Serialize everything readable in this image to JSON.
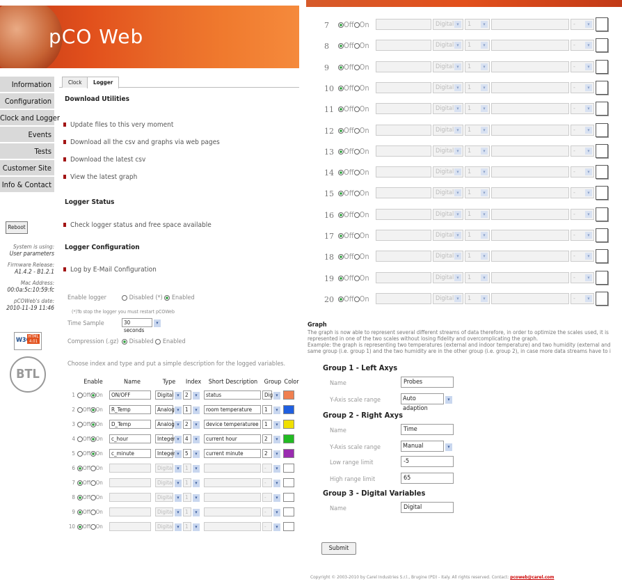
{
  "app": {
    "logo": "pCO Web"
  },
  "nav": [
    "Information",
    "Configuration",
    "Clock and Logger",
    "Events",
    "Tests",
    "Customer Site",
    "Info & Contact"
  ],
  "reboot_label": "Reboot",
  "sysinfo": [
    {
      "label": "System is using:",
      "value": "User parameters"
    },
    {
      "label": "Firmware Release:",
      "value": "A1.4.2 - B1.2.1"
    },
    {
      "label": "Mac Address:",
      "value": "00:0a:5c:10:59:fc"
    },
    {
      "label": "pCOWeb's date:",
      "value": "2010-11-19 11:46"
    }
  ],
  "badge": {
    "w3c": "W3C",
    "html": "HTML 4.01"
  },
  "seal_text": "BTL",
  "tabs": [
    "Clock",
    "Logger"
  ],
  "download": {
    "title": "Download Utilities",
    "items": [
      "Update files to this very moment",
      "Download all the csv and graphs via web pages",
      "Download the latest csv",
      "View the latest graph"
    ]
  },
  "status": {
    "title": "Logger Status",
    "item": "Check logger status and free space available"
  },
  "config": {
    "title": "Logger Configuration",
    "item": "Log by E-Mail Configuration",
    "enable_label": "Enable logger",
    "disabled_opt": "Disabled (*)",
    "enabled_opt": "Enabled",
    "note": "(*)To stop the logger you must restart pCOWeb",
    "time_label": "Time Sample",
    "time_value": "30 seconds",
    "comp_label": "Compression (.gz)",
    "comp_disabled": "Disabled",
    "comp_enabled": "Enabled",
    "choose_text": "Choose index and type and put a simple description for the logged variables."
  },
  "table": {
    "headers": [
      "Enable",
      "Name",
      "Type",
      "Index",
      "Short Description",
      "Group",
      "Color"
    ],
    "off": "Off",
    "on": "On",
    "rows": [
      {
        "n": "1",
        "name": "ON/OFF",
        "type": "Digital",
        "index": "2",
        "desc": "status",
        "group": "Dig",
        "color": "#f08050"
      },
      {
        "n": "2",
        "name": "R_Temp",
        "type": "Analog",
        "index": "1",
        "desc": "room temperature",
        "group": "1",
        "color": "#1f5fe0"
      },
      {
        "n": "3",
        "name": "D_Temp",
        "type": "Analog",
        "index": "2",
        "desc": "device temperaturee",
        "group": "1",
        "color": "#f0e000"
      },
      {
        "n": "4",
        "name": "c_hour",
        "type": "Integer",
        "index": "4",
        "desc": "current hour",
        "group": "2",
        "color": "#22bb22"
      },
      {
        "n": "5",
        "name": "c_minute",
        "type": "Integer",
        "index": "5",
        "desc": "current minute",
        "group": "2",
        "color": "#9a2bb0"
      },
      {
        "n": "6",
        "name": "",
        "type": "Digital",
        "index": "1",
        "desc": "",
        "group": "-",
        "color": "#ffffff"
      },
      {
        "n": "7",
        "name": "",
        "type": "Digital",
        "index": "1",
        "desc": "",
        "group": "-",
        "color": "#ffffff"
      },
      {
        "n": "8",
        "name": "",
        "type": "Digital",
        "index": "1",
        "desc": "",
        "group": "-",
        "color": "#ffffff"
      },
      {
        "n": "9",
        "name": "",
        "type": "Digital",
        "index": "1",
        "desc": "",
        "group": "-",
        "color": "#ffffff"
      },
      {
        "n": "10",
        "name": "",
        "type": "Digital",
        "index": "1",
        "desc": "",
        "group": "-",
        "color": "#ffffff"
      }
    ]
  },
  "right_rows": [
    "7",
    "8",
    "9",
    "10",
    "11",
    "12",
    "13",
    "14",
    "15",
    "16",
    "17",
    "18",
    "19",
    "20"
  ],
  "right_row_values": {
    "type": "Digital",
    "index": "1",
    "group": "-"
  },
  "graph": {
    "title": "Graph",
    "desc": [
      "The graph is now able to represent several different streams of data therefore, in order to optimize the scales used, it is",
      "represented in one of the two scales without losing fidelity and overcomplicating the graph.",
      "Example: the graph is representing two temperatures (external and indoor temperature) and two humidity (external and",
      "same group (i.e. group 1) and the two humidity are in the other group (i.e. group 2), in case more data streams have to i"
    ],
    "g1_title": "Group 1 - Left Axys",
    "g1_name_label": "Name",
    "g1_name": "Probes",
    "g1_scale_label": "Y-Axis scale range",
    "g1_scale": "Auto adaption",
    "g2_title": "Group 2 - Right Axys",
    "g2_name_label": "Name",
    "g2_name": "Time",
    "g2_scale_label": "Y-Axis scale range",
    "g2_scale": "Manual",
    "g2_low_label": "Low range limit",
    "g2_low": "-5",
    "g2_high_label": "High range limit",
    "g2_high": "65",
    "g3_title": "Group 3 - Digital Variables",
    "g3_name_label": "Name",
    "g3_name": "Digital"
  },
  "submit_label": "Submit",
  "copyright": {
    "text": "Copyright © 2003-2010 by Carel Industries S.r.l., Brugine (PD) - Italy. All rights reserved. Contact:",
    "email": "pcoweb@carel.com"
  }
}
